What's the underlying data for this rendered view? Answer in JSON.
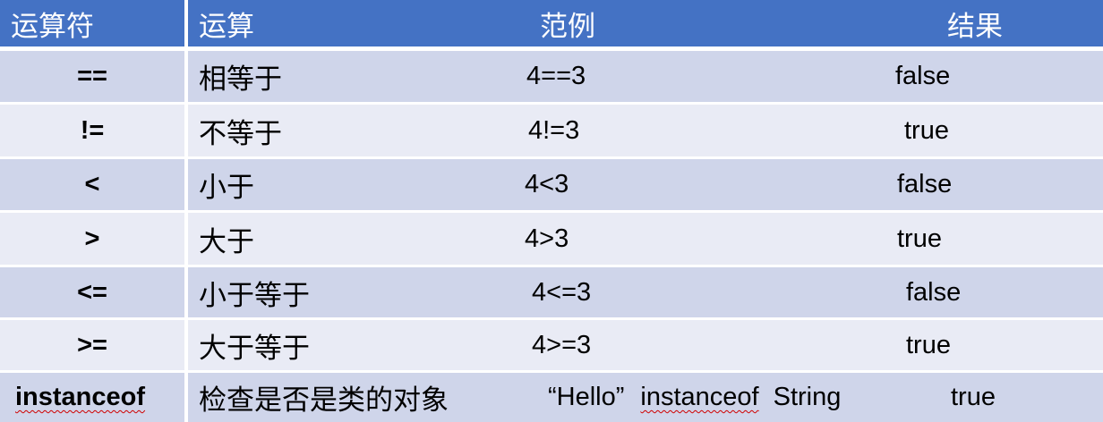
{
  "header": {
    "operator": "运算符",
    "operation": "运算",
    "example": "范例",
    "result": "结果"
  },
  "rows": [
    {
      "operator": "==",
      "operation": "相等于",
      "example": "4==3",
      "result": "false"
    },
    {
      "operator": "!=",
      "operation": "不等于",
      "example": "4!=3",
      "result": "true"
    },
    {
      "operator": "<",
      "operation": "小于",
      "example": "4<3",
      "result": "false"
    },
    {
      "operator": ">",
      "operation": "大于",
      "example": "4>3",
      "result": "true"
    },
    {
      "operator": "<=",
      "operation": "小于等于",
      "example": "4<=3",
      "result": "false"
    },
    {
      "operator": ">=",
      "operation": "大于等于",
      "example": "4>=3",
      "result": "true"
    },
    {
      "operator": "instanceof",
      "operation": "检查是否是类的对象",
      "example_parts": [
        "“Hello”",
        "instanceof",
        "String"
      ],
      "result": "true"
    }
  ],
  "colors": {
    "header_bg": "#4472C4",
    "row_dark": "#CFD5EA",
    "row_light": "#E9EBF5",
    "spellcheck_underline": "#d00000"
  }
}
